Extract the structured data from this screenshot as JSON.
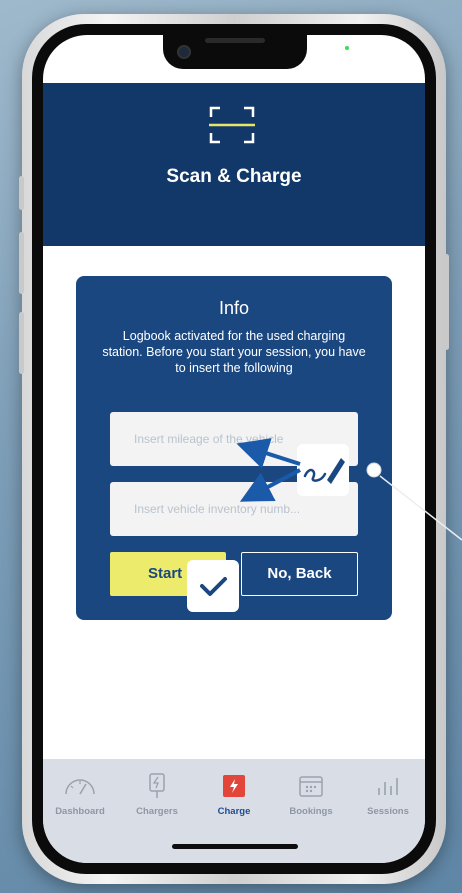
{
  "header": {
    "title": "Scan & Charge"
  },
  "info_card": {
    "title": "Info",
    "message": "Logbook activated for the used charging station. Before you start your session, you have to insert the following",
    "mileage_placeholder": "Insert mileage of the vehicle",
    "inventory_placeholder": "Insert vehicle inventory numb...",
    "start_label": "Start",
    "back_label": "No, Back"
  },
  "tabs": [
    {
      "label": "Dashboard",
      "icon": "speedometer-icon"
    },
    {
      "label": "Chargers",
      "icon": "charger-icon"
    },
    {
      "label": "Charge",
      "icon": "lightning-icon",
      "active": true
    },
    {
      "label": "Bookings",
      "icon": "calendar-icon"
    },
    {
      "label": "Sessions",
      "icon": "bar-chart-icon"
    }
  ],
  "colors": {
    "header_bg": "#12386a",
    "card_bg": "#1b4781",
    "start_button": "#eceb6c",
    "active_tab": "#e2463a",
    "scan_accent": "#e8e66a"
  }
}
